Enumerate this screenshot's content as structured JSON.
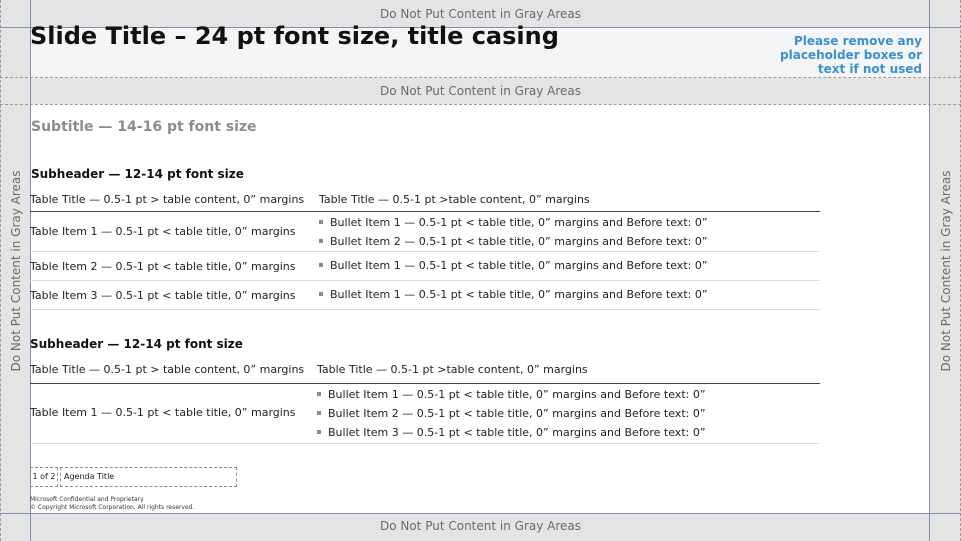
{
  "gray_area_label": "Do Not Put Content in Gray Areas",
  "slide_title": "Slide Title – 24 pt font size, title casing",
  "placeholder_note": "Please remove any placeholder boxes or text if not used",
  "subtitle": "Subtitle — 14-16 pt font size",
  "section1": {
    "subheader": "Subheader — 12-14 pt font size",
    "header_left": "Table Title — 0.5-1 pt > table content, 0” margins",
    "header_right": "Table Title — 0.5-1 pt >table content, 0” margins",
    "rows": [
      {
        "left": "Table Item 1 — 0.5-1 pt < table title, 0” margins",
        "bullets": [
          "Bullet Item 1 — 0.5-1 pt < table title, 0” margins and Before text: 0”",
          "Bullet Item 2 — 0.5-1 pt < table title, 0” margins and Before text: 0”"
        ]
      },
      {
        "left": "Table Item 2 — 0.5-1 pt < table title, 0” margins",
        "bullets": [
          "Bullet Item 1 — 0.5-1 pt < table title, 0” margins and Before text: 0”"
        ]
      },
      {
        "left": "Table Item 3 — 0.5-1 pt < table title, 0” margins",
        "bullets": [
          "Bullet Item 1 — 0.5-1 pt < table title, 0” margins and Before text: 0”"
        ]
      }
    ]
  },
  "section2": {
    "subheader": "Subheader — 12-14 pt font size",
    "header_left": "Table Title — 0.5-1 pt > table content, 0” margins",
    "header_right": "Table Title — 0.5-1 pt >table content, 0” margins",
    "rows": [
      {
        "left": "Table Item 1 — 0.5-1 pt < table title, 0” margins",
        "bullets": [
          "Bullet Item 1 — 0.5-1 pt < table title, 0” margins and Before text: 0”",
          "Bullet Item 2 — 0.5-1 pt < table title, 0” margins and Before text: 0”",
          "Bullet Item 3 — 0.5-1 pt < table title, 0” margins and Before text: 0”"
        ]
      }
    ]
  },
  "footer": {
    "page_number": "1 of 2",
    "agenda_title": "Agenda Title",
    "legal_line1": "Microsoft Confidential and Proprietary",
    "legal_line2": "© Copyright Microsoft Corporation. All rights reserved."
  },
  "colors": {
    "gray_area": "#e4e4e4",
    "title_area": "#f4f5f6",
    "accent_note": "#3f8fcc",
    "subtitle": "#8c8c8c"
  }
}
